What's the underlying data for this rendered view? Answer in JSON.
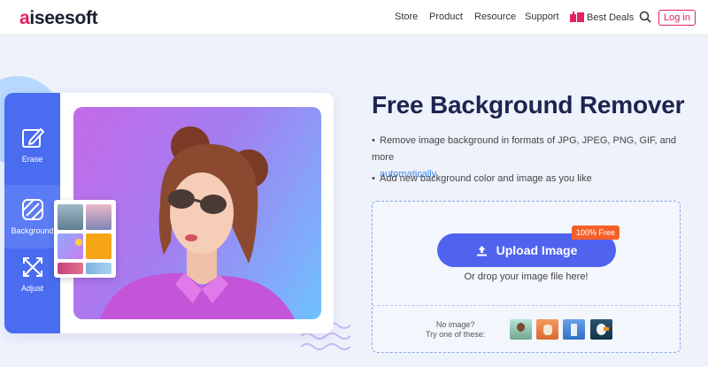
{
  "nav": {
    "logo": {
      "initial": "a",
      "rest": "iseesoft"
    },
    "items": [
      "Store",
      "Product",
      "Resource",
      "Support"
    ],
    "deals": "Best Deals",
    "login": "Log in"
  },
  "toolbar": {
    "tools": [
      {
        "label": "Erase",
        "icon": "pencil-icon"
      },
      {
        "label": "Background",
        "icon": "background-icon"
      },
      {
        "label": "Adjust",
        "icon": "expand-icon"
      }
    ],
    "active_tool": "Background"
  },
  "hero": {
    "title": "Free Background Remover",
    "bullet1_text": "Remove image background in formats of JPG, JPEG, PNG, GIF, and more",
    "bullet1_link": "automatically",
    "bullet2_text": "Add new background color and image as you like"
  },
  "upload": {
    "button_label": "Upload Image",
    "badge": "100% Free",
    "drop_text": "Or drop your image file here!",
    "no_image_line1": "No image?",
    "no_image_line2": "Try one of these:"
  },
  "colors": {
    "accent": "#4f63ee",
    "brand": "#e5215f",
    "badge": "#f5602a",
    "link": "#3d8ae8"
  }
}
